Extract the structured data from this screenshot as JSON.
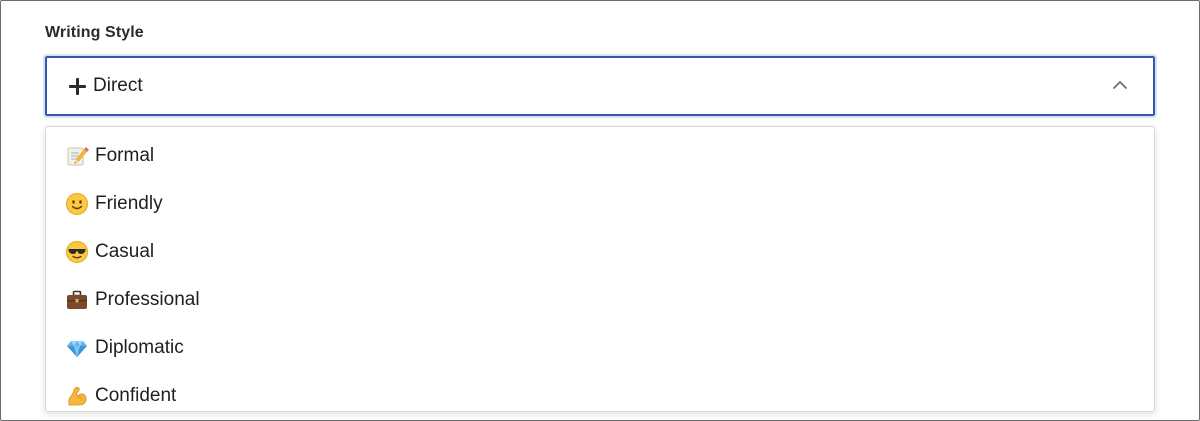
{
  "field": {
    "label": "Writing Style",
    "selected_value": "Direct",
    "selected_icon": "plus-icon"
  },
  "options": [
    {
      "label": "Formal",
      "icon": "memo-icon"
    },
    {
      "label": "Friendly",
      "icon": "smiling-face-icon"
    },
    {
      "label": "Casual",
      "icon": "sunglasses-face-icon"
    },
    {
      "label": "Professional",
      "icon": "briefcase-icon"
    },
    {
      "label": "Diplomatic",
      "icon": "gem-icon"
    },
    {
      "label": "Confident",
      "icon": "flexed-biceps-icon"
    }
  ],
  "colors": {
    "focus_border": "#3a56a8",
    "focus_ring": "#d8e1f5",
    "text": "#1f1f1f"
  }
}
